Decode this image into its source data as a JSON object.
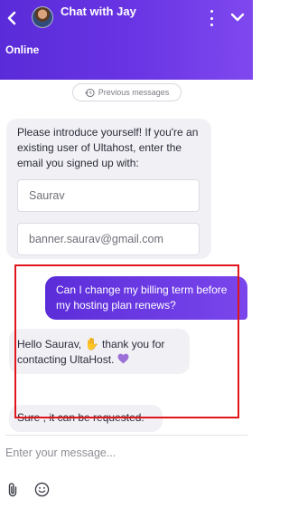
{
  "header": {
    "agent_name": "Chat with Jay",
    "status": "Online"
  },
  "history_chip": "Previous messages",
  "messages": {
    "intro": "Please introduce yourself! If you're an existing user of Ultahost, enter the email you signed up with:",
    "name_value": "Saurav",
    "email_value": "banner.saurav@gmail.com",
    "user_question": "Can I change my billing term before my hosting plan renews?",
    "greeting_start": "Hello Saurav,",
    "greeting_end": "thank you for contacting UltaHost.",
    "answer": "Sure , it  can be requested."
  },
  "composer": {
    "placeholder": "Enter your message..."
  },
  "colors": {
    "header_gradient_start": "#5a2bd8",
    "header_gradient_end": "#7f48ef",
    "incoming_bubble": "#f1f1f5",
    "selection_box": "#e0161c"
  },
  "icons": [
    "back-arrow-icon",
    "avatar",
    "more-vertical-icon",
    "chevron-down-icon",
    "history-icon",
    "waving-hand-emoji",
    "purple-heart-emoji",
    "paperclip-icon",
    "smile-icon"
  ]
}
